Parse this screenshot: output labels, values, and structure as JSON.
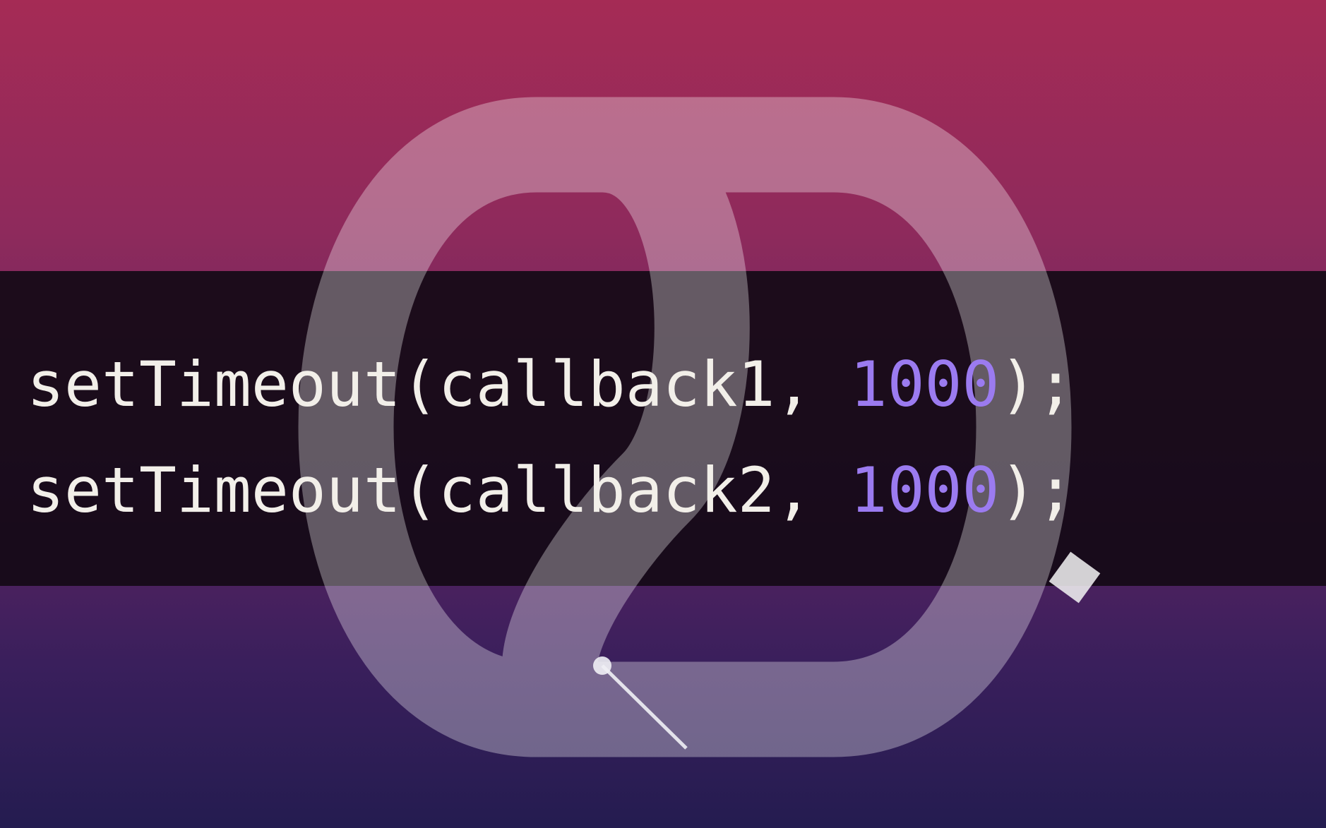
{
  "code": {
    "lines": [
      {
        "fn": "setTimeout",
        "open": "(",
        "arg": "callback1",
        "sep": ", ",
        "delay": "1000",
        "close": ");"
      },
      {
        "fn": "setTimeout",
        "open": "(",
        "arg": "callback2",
        "sep": ", ",
        "delay": "1000",
        "close": ");"
      }
    ]
  },
  "colors": {
    "text": "#f2efe9",
    "number": "#9b7bf0",
    "band": "#140a16",
    "gradient_top": "#a52b55",
    "gradient_bottom": "#241c50"
  },
  "graphic": {
    "icon": "event-loop-track-icon"
  }
}
